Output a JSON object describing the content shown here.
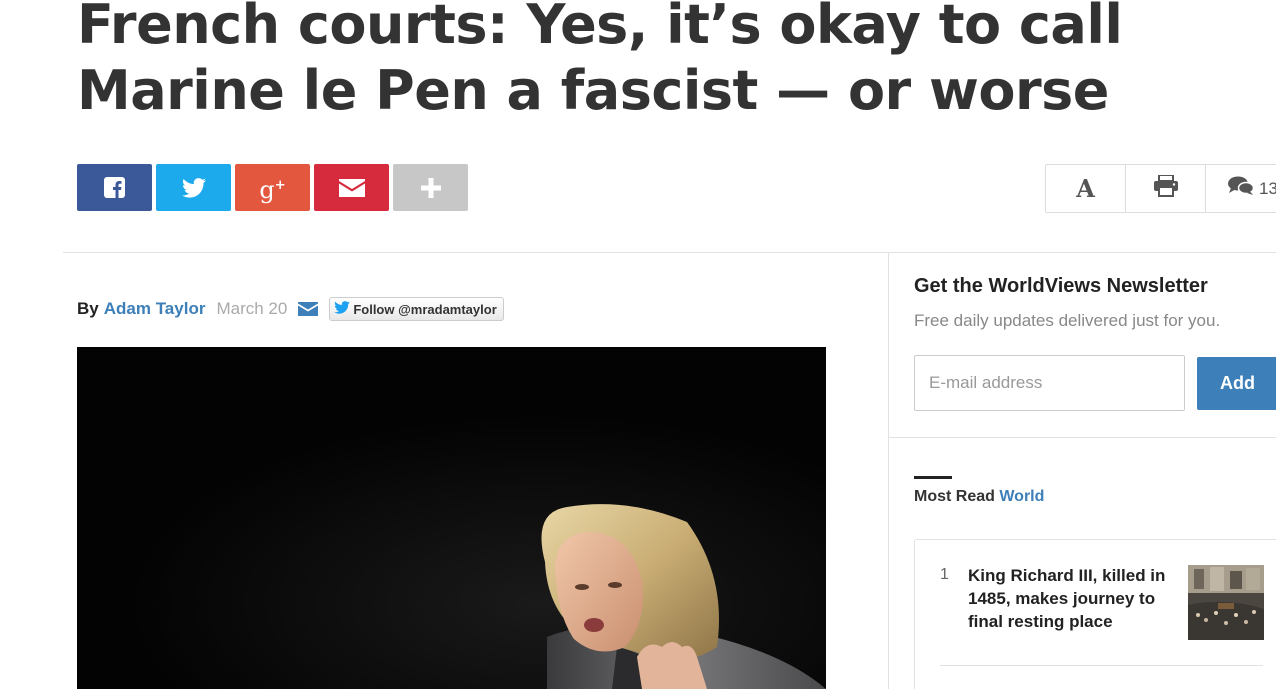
{
  "article": {
    "headline": "French courts: Yes, it’s okay to call Marine le Pen a fascist — or worse",
    "byline": {
      "by_label": "By",
      "author": "Adam Taylor",
      "date": "March 20",
      "follow_label": "Follow @mradamtaylor"
    },
    "hero_image": "marine-le-pen-photo"
  },
  "share": {
    "buttons": [
      {
        "name": "facebook",
        "icon": "facebook-icon",
        "color": "#3b5998"
      },
      {
        "name": "twitter",
        "icon": "twitter-icon",
        "color": "#1daaed"
      },
      {
        "name": "google-plus",
        "icon": "google-plus-icon",
        "color": "#e4573f",
        "glyph": "g+"
      },
      {
        "name": "email",
        "icon": "envelope-icon",
        "color": "#d52b3c"
      },
      {
        "name": "more",
        "icon": "plus-icon",
        "color": "#c7c7c7"
      }
    ]
  },
  "tools": {
    "font_size_glyph": "A",
    "print_icon": "printer-icon",
    "comments_icon": "speech-bubbles-icon",
    "comments_count": "13"
  },
  "newsletter": {
    "title": "Get the WorldViews Newsletter",
    "subtitle": "Free daily updates delivered just for you.",
    "email_placeholder": "E-mail address",
    "add_label": "Add"
  },
  "most_read": {
    "label": "Most Read",
    "section": "World",
    "items": [
      {
        "rank": "1",
        "title": "King Richard III, killed in 1485, makes journey to final resting place",
        "thumb": "procession-thumbnail"
      }
    ]
  },
  "colors": {
    "link_blue": "#3d7fb8",
    "headline": "#333333",
    "muted": "#888888"
  }
}
